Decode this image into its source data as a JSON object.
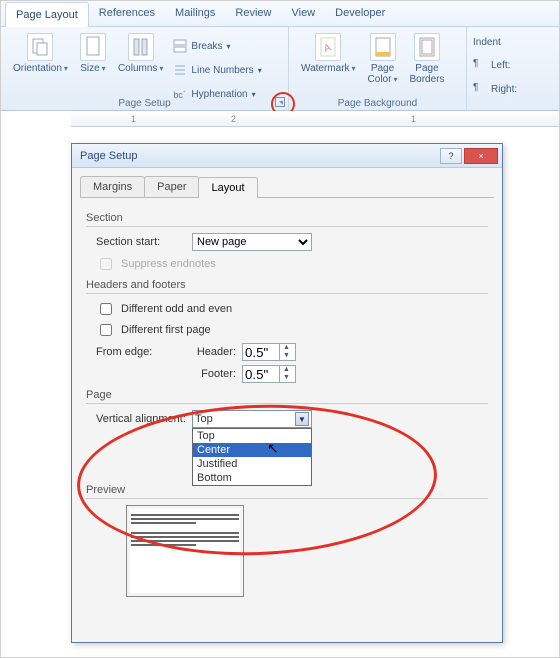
{
  "ribbon": {
    "tabs": [
      "Page Layout",
      "References",
      "Mailings",
      "Review",
      "View",
      "Developer"
    ],
    "active": 0,
    "page_setup": {
      "label": "Page Setup",
      "orientation": "Orientation",
      "size": "Size",
      "columns": "Columns",
      "breaks": "Breaks",
      "line_numbers": "Line Numbers",
      "hyphenation": "Hyphenation"
    },
    "page_background": {
      "label": "Page Background",
      "watermark": "Watermark",
      "page_color": "Page\nColor",
      "page_borders": "Page\nBorders"
    },
    "paragraph": {
      "label": "Indent",
      "left": "Left:",
      "right": "Right:"
    }
  },
  "ruler": {
    "marks": [
      "1",
      "2",
      "1"
    ]
  },
  "dialog": {
    "title": "Page Setup",
    "help": "?",
    "close": "×",
    "tabs": [
      "Margins",
      "Paper",
      "Layout"
    ],
    "active_tab": 2,
    "section": {
      "title": "Section",
      "start_label": "Section start:",
      "start_value": "New page",
      "suppress": "Suppress endnotes"
    },
    "hf": {
      "title": "Headers and footers",
      "odd_even": "Different odd and even",
      "first": "Different first page",
      "from_edge": "From edge:",
      "header_label": "Header:",
      "header_val": "0.5\"",
      "footer_label": "Footer:",
      "footer_val": "0.5\""
    },
    "page": {
      "title": "Page",
      "va_label": "Vertical alignment:",
      "va_value": "Top",
      "va_options": [
        "Top",
        "Center",
        "Justified",
        "Bottom"
      ],
      "va_highlight": 1
    },
    "preview": "Preview"
  }
}
